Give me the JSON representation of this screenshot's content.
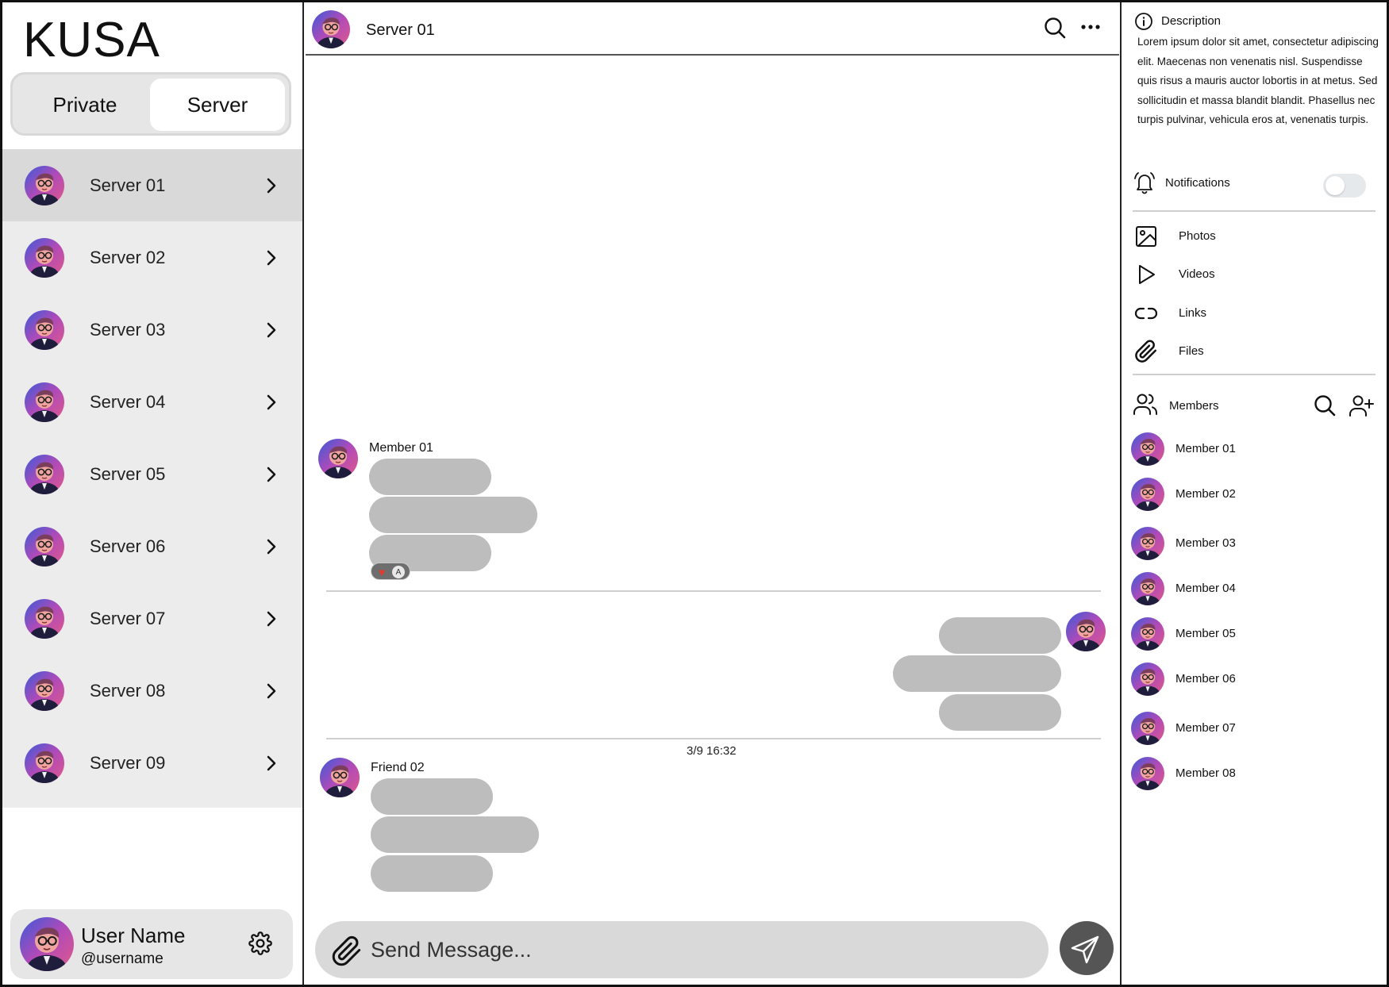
{
  "app": {
    "title": "KUSA"
  },
  "tabs": {
    "private": "Private",
    "server": "Server",
    "selected": "Server"
  },
  "servers": [
    {
      "label": "Server 01",
      "active": true
    },
    {
      "label": "Server 02"
    },
    {
      "label": "Server 03"
    },
    {
      "label": "Server 04"
    },
    {
      "label": "Server 05"
    },
    {
      "label": "Server 06"
    },
    {
      "label": "Server 07"
    },
    {
      "label": "Server 08"
    },
    {
      "label": "Server 09"
    }
  ],
  "user": {
    "name": "User Name",
    "handle": "@username"
  },
  "chat": {
    "title": "Server 01",
    "messages": [
      {
        "sender": "Member 01",
        "reaction": {
          "emoji": "heart",
          "letter": "A"
        }
      },
      {
        "sender": "me"
      },
      {
        "sender": "Friend 02",
        "timestamp": "3/9 16:32"
      }
    ],
    "composer_placeholder": "Send Message..."
  },
  "details": {
    "description_title": "Description",
    "description_text": "Lorem ipsum dolor sit amet, consectetur adipiscing elit. Maecenas non venenatis nisl. Suspendisse quis risus a mauris auctor lobortis in at metus. Sed sollicitudin et massa blandit blandit. Phasellus nec turpis pulvinar, vehicula eros at, venenatis turpis.",
    "notifications_label": "Notifications",
    "notifications_on": false,
    "media": [
      {
        "label": "Photos",
        "icon": "image-icon"
      },
      {
        "label": "Videos",
        "icon": "play-icon"
      },
      {
        "label": "Links",
        "icon": "link-icon"
      },
      {
        "label": "Files",
        "icon": "paperclip-icon"
      }
    ],
    "members_label": "Members",
    "members": [
      "Member 01",
      "Member 02",
      "Member 03",
      "Member 04",
      "Member 05",
      "Member 06",
      "Member 07",
      "Member 08"
    ]
  },
  "colors": {
    "bubble": "#bdbdbd",
    "sidebar_bg": "#ececec",
    "active_bg": "#d9d9d9",
    "send_button": "#555555",
    "heart": "#e23a2b"
  }
}
